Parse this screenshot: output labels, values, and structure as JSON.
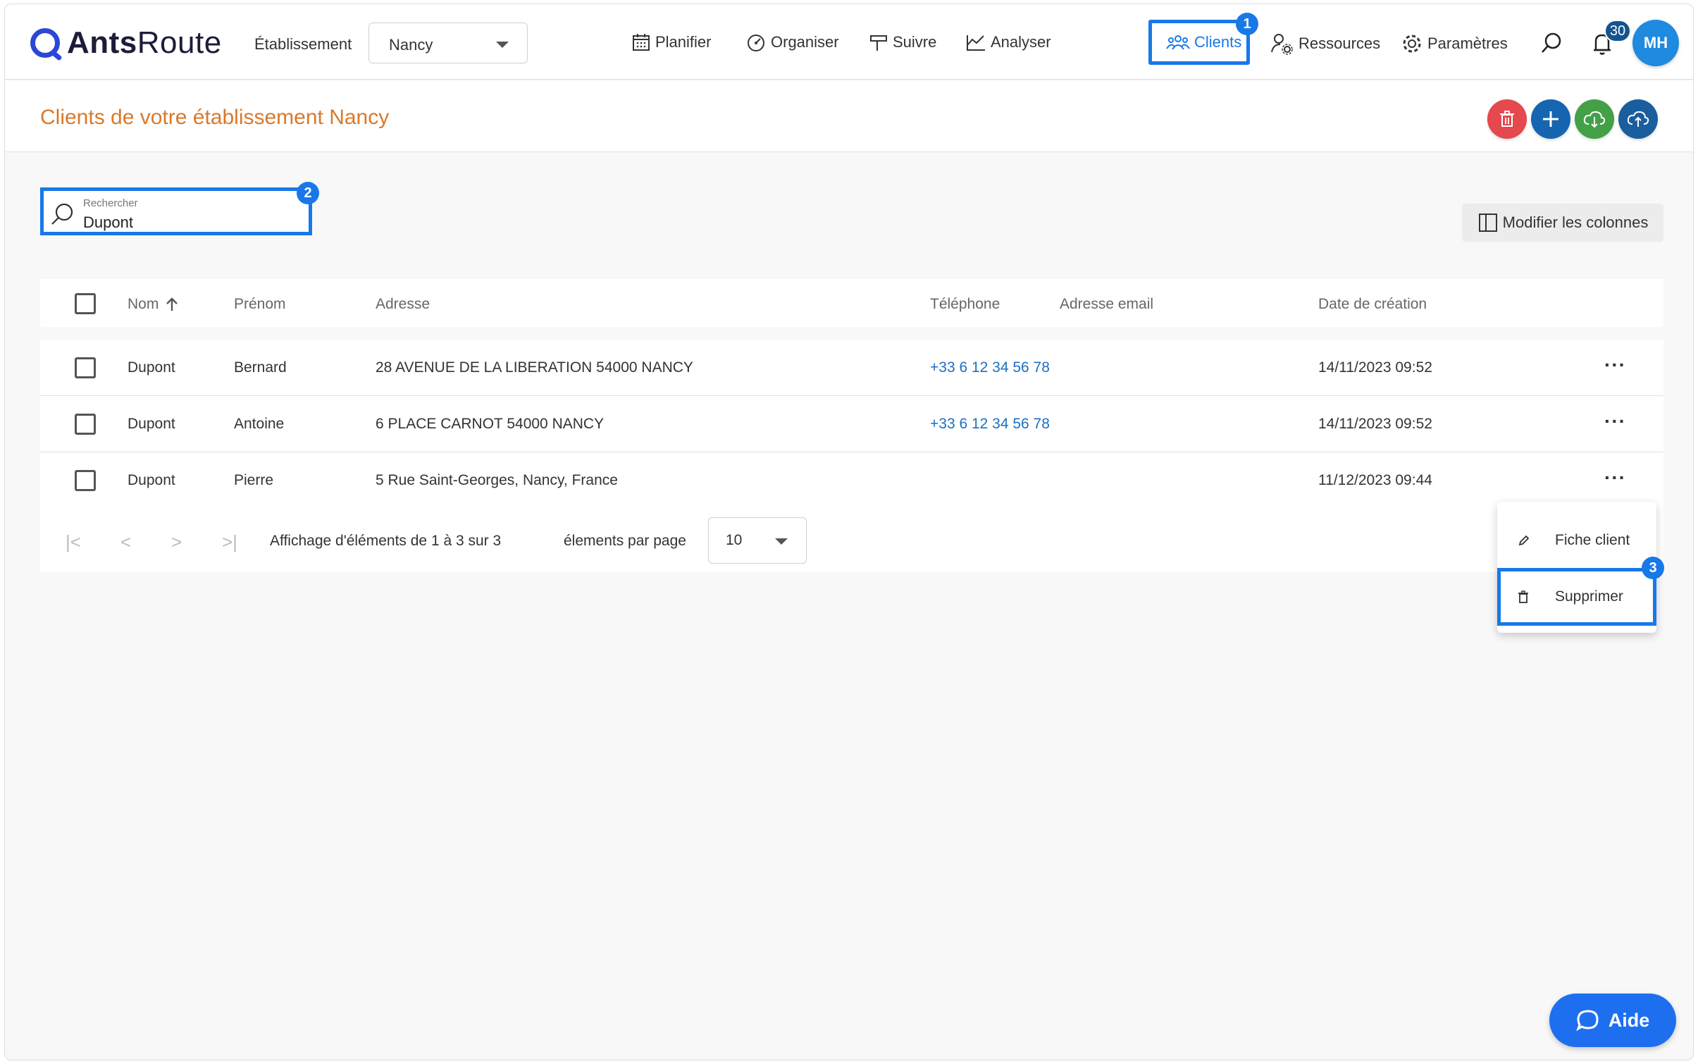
{
  "header": {
    "logo_text_bold": "Ants",
    "logo_text_light": "Route",
    "establishment_label": "Établissement",
    "establishment_value": "Nancy",
    "nav": {
      "planifier": "Planifier",
      "organiser": "Organiser",
      "suivre": "Suivre",
      "analyser": "Analyser",
      "clients": "Clients",
      "ressources": "Ressources",
      "parametres": "Paramètres"
    },
    "notification_count": "30",
    "avatar_initials": "MH"
  },
  "step_markers": {
    "one": "1",
    "two": "2",
    "three": "3"
  },
  "page": {
    "title": "Clients de votre établissement Nancy"
  },
  "search": {
    "label": "Rechercher",
    "value": "Dupont"
  },
  "columns_button": "Modifier les colonnes",
  "table": {
    "headers": {
      "nom": "Nom",
      "prenom": "Prénom",
      "adresse": "Adresse",
      "telephone": "Téléphone",
      "email": "Adresse email",
      "date": "Date de création"
    },
    "rows": [
      {
        "nom": "Dupont",
        "prenom": "Bernard",
        "adresse": "28 AVENUE DE LA LIBERATION 54000 NANCY",
        "telephone": "+33 6 12 34 56 78",
        "email": "",
        "date": "14/11/2023 09:52"
      },
      {
        "nom": "Dupont",
        "prenom": "Antoine",
        "adresse": "6 PLACE CARNOT 54000 NANCY",
        "telephone": "+33 6 12 34 56 78",
        "email": "",
        "date": "14/11/2023 09:52"
      },
      {
        "nom": "Dupont",
        "prenom": "Pierre",
        "adresse": "5 Rue Saint-Georges, Nancy, France",
        "telephone": "",
        "email": "",
        "date": "11/12/2023 09:44"
      }
    ]
  },
  "pager": {
    "summary": "Affichage d'éléments de 1 à 3 sur 3",
    "per_page_label": "élements par page",
    "per_page_value": "10"
  },
  "context_menu": {
    "fiche_client": "Fiche client",
    "supprimer": "Supprimer"
  },
  "help_button": "Aide",
  "colors": {
    "accent_blue": "#1878e8",
    "title_orange": "#d9792a",
    "delete_red": "#e5484d",
    "add_blue": "#1565b0",
    "import_green": "#43a047",
    "export_blue": "#1a5e9e"
  }
}
